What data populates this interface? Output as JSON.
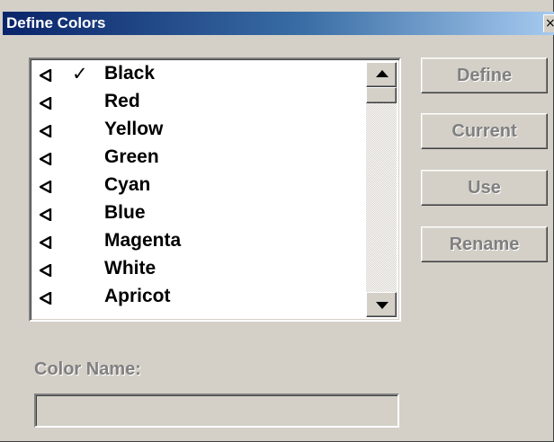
{
  "window": {
    "title": "Define Colors",
    "close_glyph": "×"
  },
  "colors": {
    "accent_title_start": "#0a246a",
    "accent_title_end": "#a6caf0",
    "dialog_bg": "#d4d0c8",
    "disabled_text": "#808080"
  },
  "color_list": {
    "items": [
      {
        "label": "Black",
        "check": "✓",
        "icon": "speaker-triangle-icon"
      },
      {
        "label": "Red",
        "check": "",
        "icon": "speaker-triangle-icon"
      },
      {
        "label": "Yellow",
        "check": "",
        "icon": "speaker-triangle-icon"
      },
      {
        "label": "Green",
        "check": "",
        "icon": "speaker-triangle-icon"
      },
      {
        "label": "Cyan",
        "check": "",
        "icon": "speaker-triangle-icon"
      },
      {
        "label": "Blue",
        "check": "",
        "icon": "speaker-triangle-icon"
      },
      {
        "label": "Magenta",
        "check": "",
        "icon": "speaker-triangle-icon"
      },
      {
        "label": "White",
        "check": "",
        "icon": "speaker-triangle-icon"
      },
      {
        "label": "Apricot",
        "check": "",
        "icon": "speaker-triangle-icon"
      }
    ],
    "selected": "Black"
  },
  "buttons": {
    "define": "Define",
    "current": "Current",
    "use": "Use",
    "rename": "Rename"
  },
  "color_name": {
    "label": "Color Name:",
    "value": ""
  }
}
